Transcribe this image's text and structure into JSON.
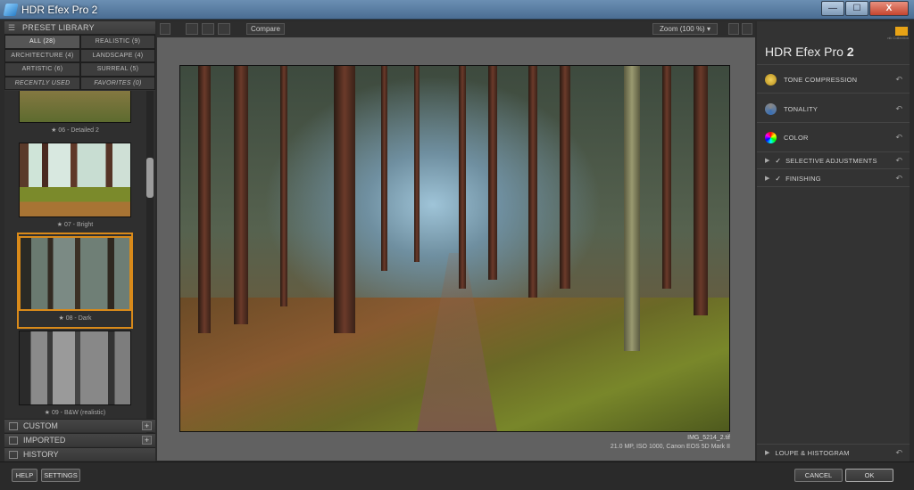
{
  "window": {
    "title": "HDR Efex Pro 2",
    "btn_min": "—",
    "btn_max": "☐",
    "btn_close": "X"
  },
  "left": {
    "library_title": "PRESET LIBRARY",
    "categories": [
      {
        "label": "ALL (28)"
      },
      {
        "label": "REALISTIC (9)"
      },
      {
        "label": "ARCHITECTURE (4)"
      },
      {
        "label": "LANDSCAPE (4)"
      },
      {
        "label": "ARTISTIC (6)"
      },
      {
        "label": "SURREAL (5)"
      },
      {
        "label": "RECENTLY USED"
      },
      {
        "label": "FAVORITES (0)"
      }
    ],
    "presets": [
      {
        "label": "★ 06 - Detailed 2"
      },
      {
        "label": "★ 07 - Bright"
      },
      {
        "label": "★ 08 - Dark"
      },
      {
        "label": "★ 09 - B&W (realistic)"
      }
    ],
    "custom": "CUSTOM",
    "imported": "IMPORTED",
    "history": "HISTORY",
    "plus": "+"
  },
  "toolbar": {
    "compare": "Compare",
    "zoom": "Zoom (100 %) ▾"
  },
  "image": {
    "filename": "IMG_5214_2.tif",
    "meta": "21.0 MP, ISO 1000, Canon EOS 5D Mark II"
  },
  "right": {
    "brand": "nik Collection",
    "product": "HDR Efex Pro",
    "version": "2",
    "sections": {
      "tone": "TONE COMPRESSION",
      "tonality": "TONALITY",
      "color": "COLOR",
      "selective": "SELECTIVE ADJUSTMENTS",
      "finishing": "FINISHING",
      "loupe": "LOUPE & HISTOGRAM"
    },
    "reset_glyph": "↶",
    "chevron": "▶",
    "check": "✓"
  },
  "bottom": {
    "help": "HELP",
    "settings": "SETTINGS",
    "cancel": "CANCEL",
    "ok": "OK"
  }
}
